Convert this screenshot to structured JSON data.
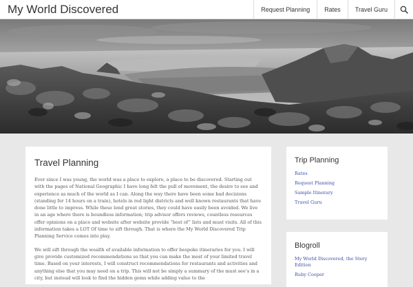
{
  "header": {
    "site_title": "My World Discovered",
    "nav": [
      "Request Planning",
      "Rates",
      "Travel Guru"
    ],
    "search_icon": "search-icon"
  },
  "main": {
    "title": "Travel Planning",
    "paragraphs": [
      "Ever since I was young, the world was a place to explore, a place to be discovered.  Starting out with the pages of National Geographic I have long felt the pull of movement, the desire to see and experience as much of the world as I can.  Along the way there have been some bad decisions (standing for 14 hours on a train), hotels in red light districts and well known restaurants that have done little to impress.  While these lend great stories, they could have easily been avoided.  We live in an age where there is boundless information; trip advisor offers reviews, countless resources offer opinions on a place and website after website provide “best of” lists and must visits.  All of this information takes a LOT Of time to sift through.  That is where the My World Discovered Trip Planning Service comes into play.",
      "We will sift through the wealth of available information to offer bespoke itineraries for you.  I will give provide customized recommendations so that you can make the most of your limited travel time.  Based on your interests, I will construct recommendations for restaurants and activities and anything else that you may need on a trip.  This will not be simply a summary of the must see’s in a city, but instead will look to find the hidden gems while adding value to the"
    ]
  },
  "sidebar": {
    "trip_planning": {
      "title": "Trip Planning",
      "links": [
        "Rates",
        "Request Planning",
        "Sample Itinerary",
        "Travel Guru"
      ]
    },
    "blogroll": {
      "title": "Blogroll",
      "links": [
        "My World Discovered, the Story Edition",
        "Ruby Cooper"
      ]
    }
  },
  "colors": {
    "background": "#e8e8e8",
    "link": "#3a4fa8",
    "text": "#333333"
  }
}
